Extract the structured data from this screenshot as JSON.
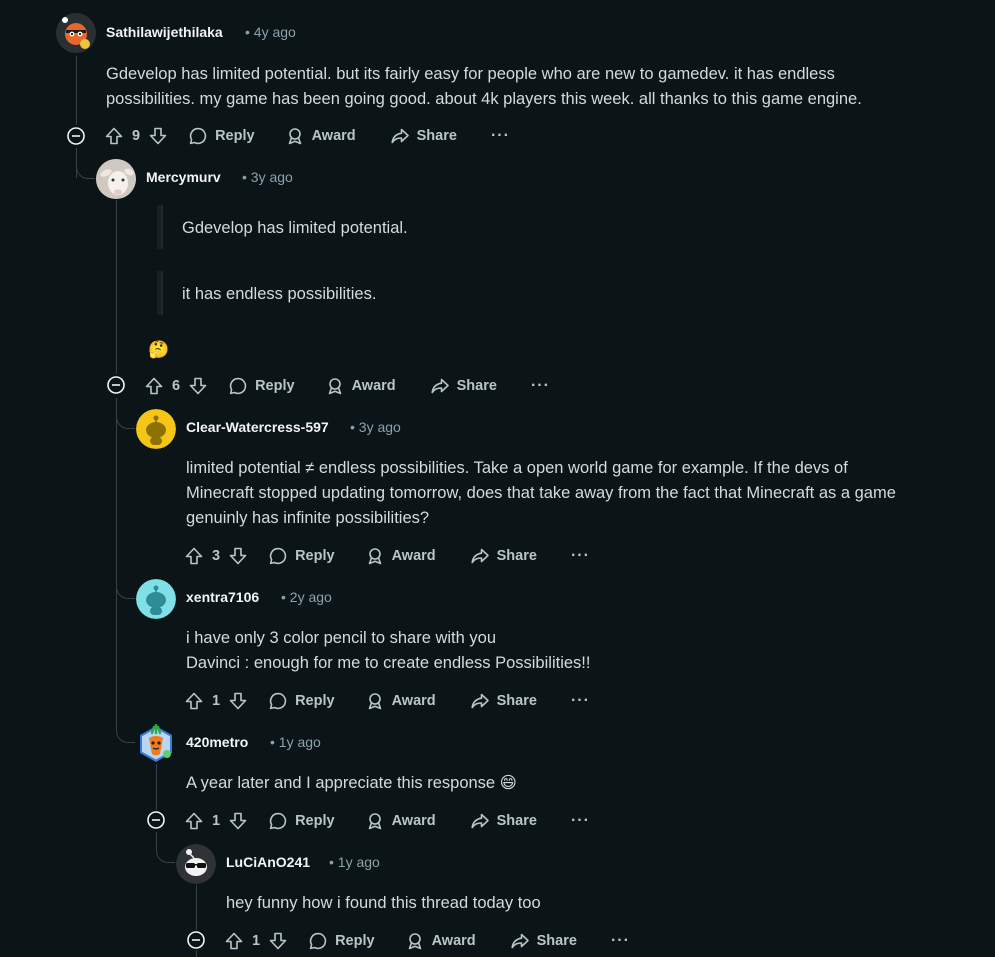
{
  "colors": {
    "background": "#0b1416",
    "text": "#d7dadc",
    "meta": "#8ba2ad",
    "line": "#39424a"
  },
  "labels": {
    "reply": "Reply",
    "award": "Award",
    "share": "Share",
    "more": "···"
  },
  "comments": [
    {
      "author": "Sathilawijethilaka",
      "time": "• 4y ago",
      "body": [
        "Gdevelop has limited potential. but its fairly easy for people who are new to gamedev. it has endless",
        "possibilities. my game has been going good. about 4k players this week. all thanks to this game engine."
      ],
      "votes": "9",
      "avatar": "snoo-tiger-avatar"
    },
    {
      "author": "Mercymurv",
      "time": "• 3y ago",
      "quotes": [
        "Gdevelop has limited potential.",
        "it has endless possibilities."
      ],
      "emoji": "🤔",
      "votes": "6",
      "avatar": "goat-avatar"
    },
    {
      "author": "Clear-Watercress-597",
      "time": "• 3y ago",
      "body": [
        "limited potential ≠ endless possibilities. Take a open world game for example. If the devs of",
        "Minecraft stopped updating tomorrow, does that take away from the fact that Minecraft as a game",
        "genuinly has infinite possibilities?"
      ],
      "votes": "3",
      "avatar": "yellow-snoo-avatar"
    },
    {
      "author": "xentra7106",
      "time": "• 2y ago",
      "body": [
        "i have only 3 color pencil to share with you",
        "Davinci : enough for me to create endless Possibilities!!"
      ],
      "votes": "1",
      "avatar": "cyan-snoo-avatar"
    },
    {
      "author": "420metro",
      "time": "• 1y ago",
      "body": [
        "A year later and I appreciate this response 😄"
      ],
      "votes": "1",
      "avatar": "carrot-avatar"
    },
    {
      "author": "LuCiAnO241",
      "time": "• 1y ago",
      "body": [
        "hey funny how i found this thread today too"
      ],
      "votes": "1",
      "avatar": "sunglasses-snoo-avatar"
    }
  ]
}
